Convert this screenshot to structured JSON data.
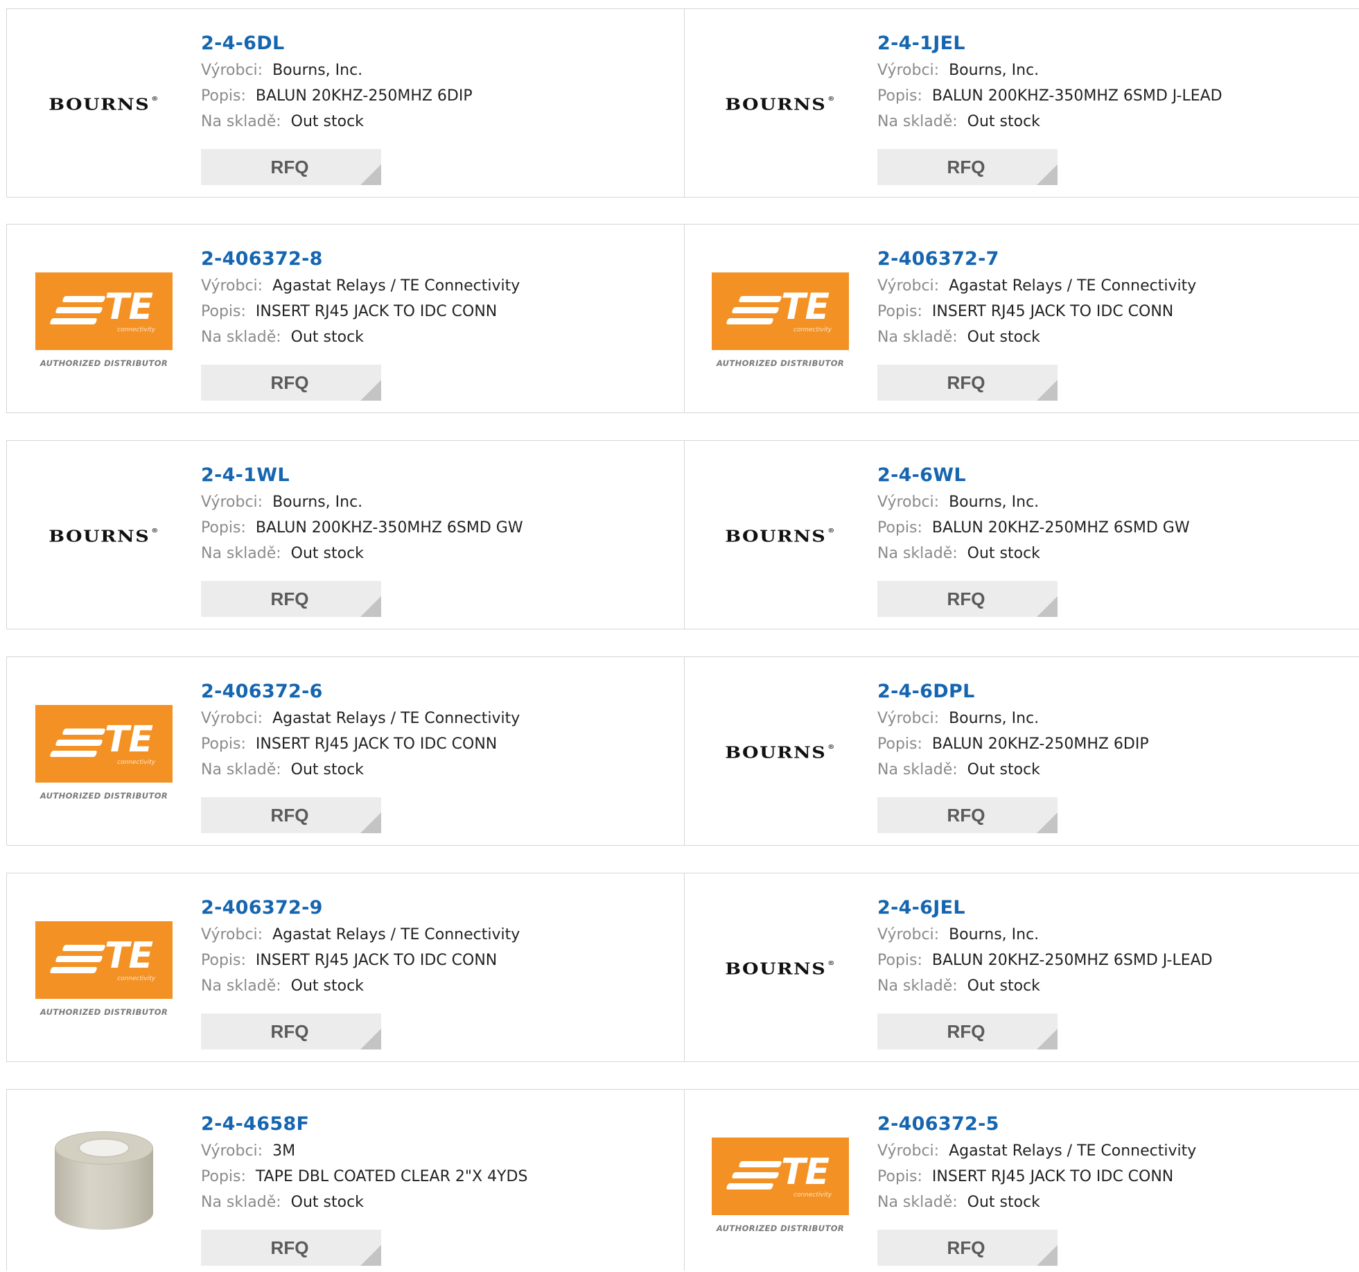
{
  "labels": {
    "manufacturer": "Výrobci:",
    "description": "Popis:",
    "stock": "Na skladě:",
    "rfq": "RFQ"
  },
  "logos": {
    "bourns_text": "BOURNS",
    "bourns_mark": "®",
    "te_text": "TE",
    "te_sub": "connectivity",
    "te_authorized": "AUTHORIZED DISTRIBUTOR"
  },
  "colors": {
    "link": "#1565b0",
    "te_orange": "#f39124",
    "button_bg": "#ececec"
  },
  "products": [
    {
      "logo": "bourns",
      "part": "2-4-6DL",
      "manufacturer": "Bourns, Inc.",
      "description": "BALUN 20KHZ-250MHZ 6DIP",
      "stock": "Out stock"
    },
    {
      "logo": "bourns",
      "part": "2-4-1JEL",
      "manufacturer": "Bourns, Inc.",
      "description": "BALUN 200KHZ-350MHZ 6SMD J-LEAD",
      "stock": "Out stock"
    },
    {
      "logo": "te",
      "part": "2-406372-8",
      "manufacturer": "Agastat Relays / TE Connectivity",
      "description": "INSERT RJ45 JACK TO IDC CONN",
      "stock": "Out stock"
    },
    {
      "logo": "te",
      "part": "2-406372-7",
      "manufacturer": "Agastat Relays / TE Connectivity",
      "description": "INSERT RJ45 JACK TO IDC CONN",
      "stock": "Out stock"
    },
    {
      "logo": "bourns",
      "part": "2-4-1WL",
      "manufacturer": "Bourns, Inc.",
      "description": "BALUN 200KHZ-350MHZ 6SMD GW",
      "stock": "Out stock"
    },
    {
      "logo": "bourns",
      "part": "2-4-6WL",
      "manufacturer": "Bourns, Inc.",
      "description": "BALUN 20KHZ-250MHZ 6SMD GW",
      "stock": "Out stock"
    },
    {
      "logo": "te",
      "part": "2-406372-6",
      "manufacturer": "Agastat Relays / TE Connectivity",
      "description": "INSERT RJ45 JACK TO IDC CONN",
      "stock": "Out stock"
    },
    {
      "logo": "bourns",
      "part": "2-4-6DPL",
      "manufacturer": "Bourns, Inc.",
      "description": "BALUN 20KHZ-250MHZ 6DIP",
      "stock": "Out stock"
    },
    {
      "logo": "te",
      "part": "2-406372-9",
      "manufacturer": "Agastat Relays / TE Connectivity",
      "description": "INSERT RJ45 JACK TO IDC CONN",
      "stock": "Out stock"
    },
    {
      "logo": "bourns",
      "part": "2-4-6JEL",
      "manufacturer": "Bourns, Inc.",
      "description": "BALUN 20KHZ-250MHZ 6SMD J-LEAD",
      "stock": "Out stock"
    },
    {
      "logo": "tape",
      "part": "2-4-4658F",
      "manufacturer": "3M",
      "description": "TAPE DBL COATED CLEAR 2\"X 4YDS",
      "stock": "Out stock"
    },
    {
      "logo": "te",
      "part": "2-406372-5",
      "manufacturer": "Agastat Relays / TE Connectivity",
      "description": "INSERT RJ45 JACK TO IDC CONN",
      "stock": "Out stock"
    }
  ]
}
